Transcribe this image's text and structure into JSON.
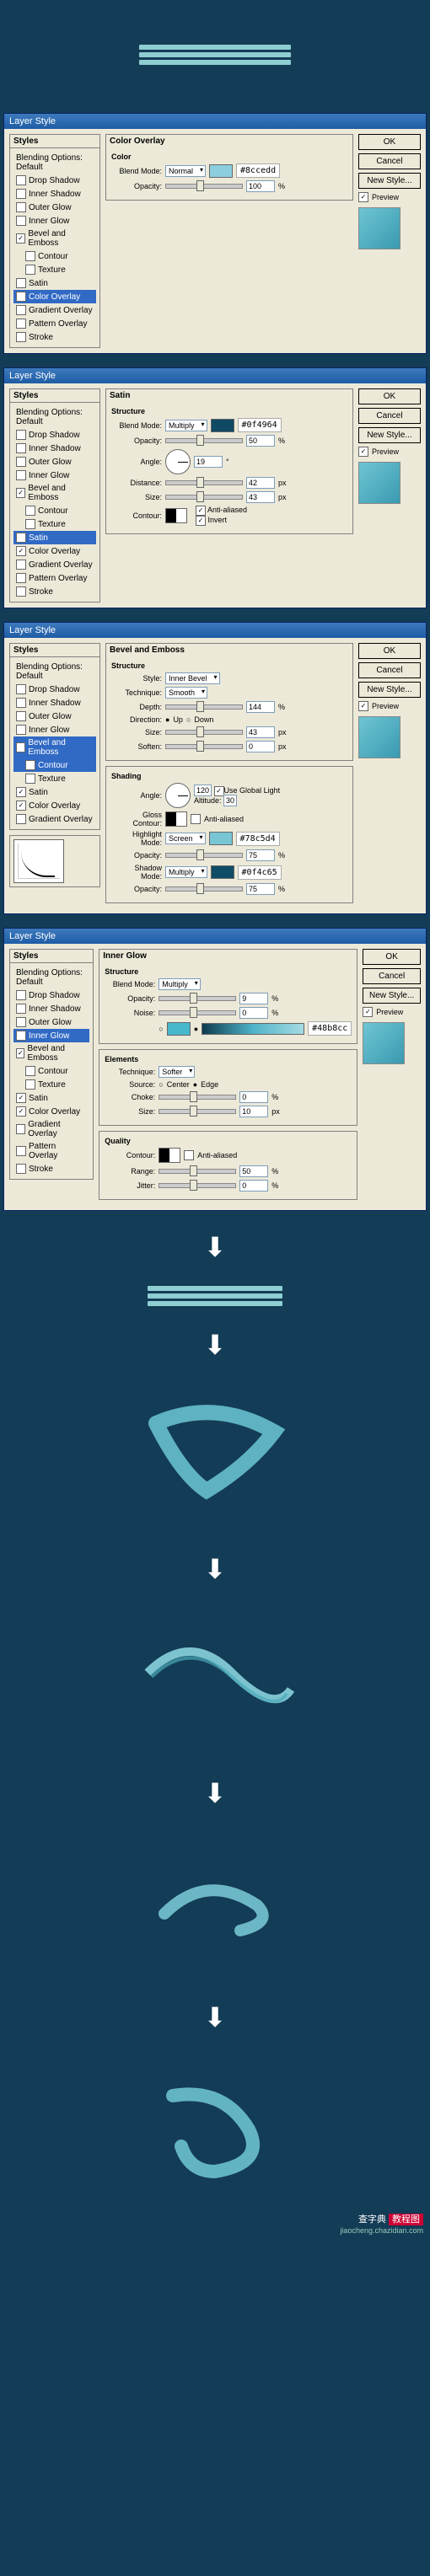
{
  "dialog_title": "Layer Style",
  "buttons": {
    "ok": "OK",
    "cancel": "Cancel",
    "new_style": "New Style...",
    "preview": "Preview"
  },
  "styles_section": {
    "header": "Styles",
    "default": "Blending Options: Default",
    "items": [
      "Drop Shadow",
      "Inner Shadow",
      "Outer Glow",
      "Inner Glow",
      "Bevel and Emboss",
      "Contour",
      "Texture",
      "Satin",
      "Color Overlay",
      "Gradient Overlay",
      "Pattern Overlay",
      "Stroke"
    ]
  },
  "labels": {
    "blend_mode": "Blend Mode:",
    "opacity": "Opacity:",
    "angle": "Angle:",
    "distance": "Distance:",
    "size": "Size:",
    "contour": "Contour:",
    "anti_aliased": "Anti-aliased",
    "invert": "Invert",
    "style": "Style:",
    "technique": "Technique:",
    "depth": "Depth:",
    "direction": "Direction:",
    "up": "Up",
    "down": "Down",
    "soften": "Soften:",
    "altitude": "Altitude:",
    "use_global": "Use Global Light",
    "gloss_contour": "Gloss Contour:",
    "highlight_mode": "Highlight Mode:",
    "shadow_mode": "Shadow Mode:",
    "noise": "Noise:",
    "source": "Source:",
    "center": "Center",
    "edge": "Edge",
    "choke": "Choke:",
    "range": "Range:",
    "jitter": "Jitter:",
    "px": "px",
    "pct": "%",
    "deg": "°"
  },
  "panels": {
    "color_overlay": {
      "title": "Color Overlay",
      "sub": "Color",
      "blend_mode": "Normal",
      "opacity": "100",
      "color": "#8ccedd"
    },
    "satin": {
      "title": "Satin",
      "sub": "Structure",
      "blend_mode": "Multiply",
      "opacity": "50",
      "angle": "19",
      "distance": "42",
      "size": "43",
      "color": "#0f4964"
    },
    "bevel": {
      "title": "Bevel and Emboss",
      "sub": "Structure",
      "style": "Inner Bevel",
      "technique": "Smooth",
      "depth": "144",
      "size": "43",
      "soften": "0",
      "shading": "Shading",
      "angle": "120",
      "altitude": "30",
      "highlight_mode": "Screen",
      "highlight_opacity": "75",
      "shadow_mode": "Multiply",
      "shadow_opacity": "75",
      "hl_color": "#78c5d4",
      "sh_color": "#0f4c65"
    },
    "inner_glow": {
      "title": "Inner Glow",
      "sub": "Structure",
      "blend_mode": "Multiply",
      "opacity": "9",
      "noise": "0",
      "color": "#48b8cc",
      "elements": "Elements",
      "technique": "Softer",
      "choke": "0",
      "size": "10",
      "quality": "Quality",
      "range": "50",
      "jitter": "0"
    }
  },
  "footer": {
    "text": "查字典",
    "brand": "教程图",
    "url": "jiaocheng.chazidian.com"
  },
  "chart_data": null
}
